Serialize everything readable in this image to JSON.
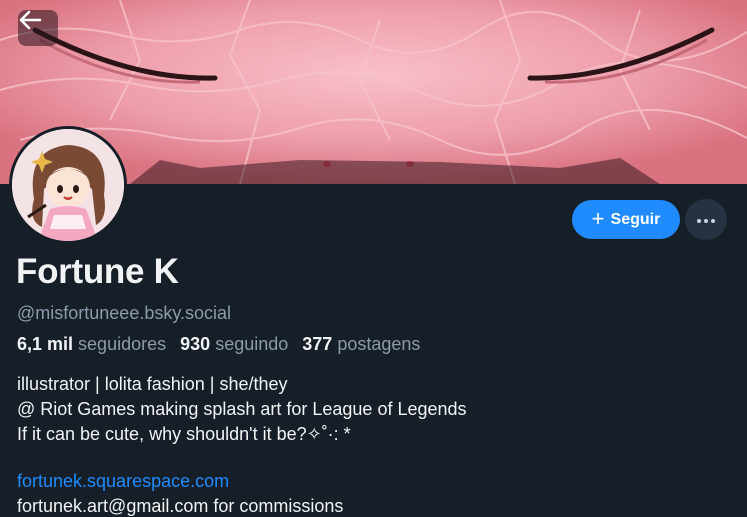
{
  "profile": {
    "display_name": "Fortune K",
    "handle": "@misfortuneee.bsky.social",
    "followers_count": "6,1 mil",
    "followers_label": "seguidores",
    "following_count": "930",
    "following_label": "seguindo",
    "posts_count": "377",
    "posts_label": "postagens",
    "bio_lines": [
      "illustrator | lolita fashion | she/they",
      "@ Riot Games making splash art for League of Legends",
      "If it can be cute, why shouldn't it be?✧˚·: *"
    ],
    "website": "fortunek.squarespace.com",
    "cut_line": "fortunek.art@gmail.com for commissions"
  },
  "actions": {
    "follow_label": "Seguir",
    "follow_icon": "plus-icon",
    "more_icon": "ellipsis-icon",
    "back_icon": "arrow-left-icon"
  },
  "colors": {
    "background": "#161e27",
    "accent": "#208bfe",
    "muted_text": "#8d9aac",
    "primary_text": "#f1f3f5"
  }
}
